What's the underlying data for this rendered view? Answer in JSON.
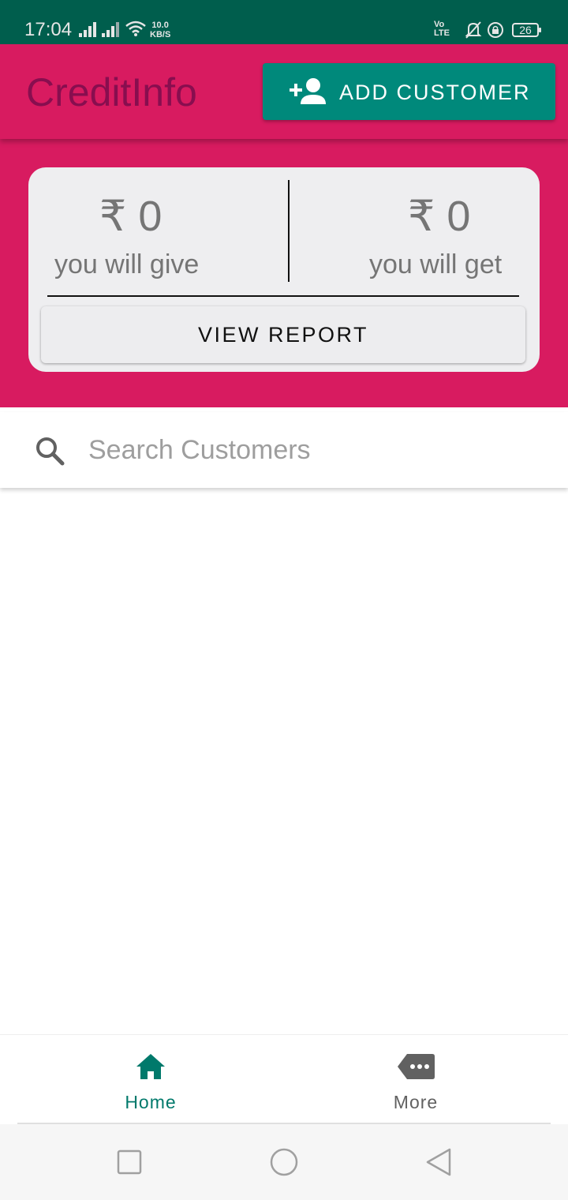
{
  "status_bar": {
    "time": "17:04",
    "net_speed_value": "10.0",
    "net_speed_unit": "KB/S",
    "volte_top": "Vo",
    "volte_bottom": "LTE",
    "battery": "26",
    "icons": [
      "signal-icon",
      "signal-icon",
      "wifi-icon",
      "volte-icon",
      "bell-muted-icon",
      "rotation-lock-icon",
      "battery-icon"
    ]
  },
  "app_bar": {
    "title": "CreditInfo",
    "add_customer_label": "ADD CUSTOMER",
    "add_customer_icon": "person-add-icon"
  },
  "summary": {
    "give_amount": "₹ 0",
    "give_label": "you will give",
    "get_amount": "₹ 0",
    "get_label": "you will get",
    "view_report_label": "VIEW REPORT"
  },
  "search": {
    "placeholder": "Search Customers",
    "value": "",
    "icon": "search-icon"
  },
  "bottom_nav": {
    "items": [
      {
        "label": "Home",
        "icon": "home-icon",
        "active": true
      },
      {
        "label": "More",
        "icon": "more-tag-icon",
        "active": false
      }
    ]
  },
  "system_nav": [
    "recent-apps-icon",
    "home-circle-icon",
    "back-icon"
  ],
  "colors": {
    "status_bar": "#005e4d",
    "primary": "#d81b60",
    "title_text": "#880e4f",
    "accent": "#00897b",
    "active_nav": "#00796b"
  }
}
